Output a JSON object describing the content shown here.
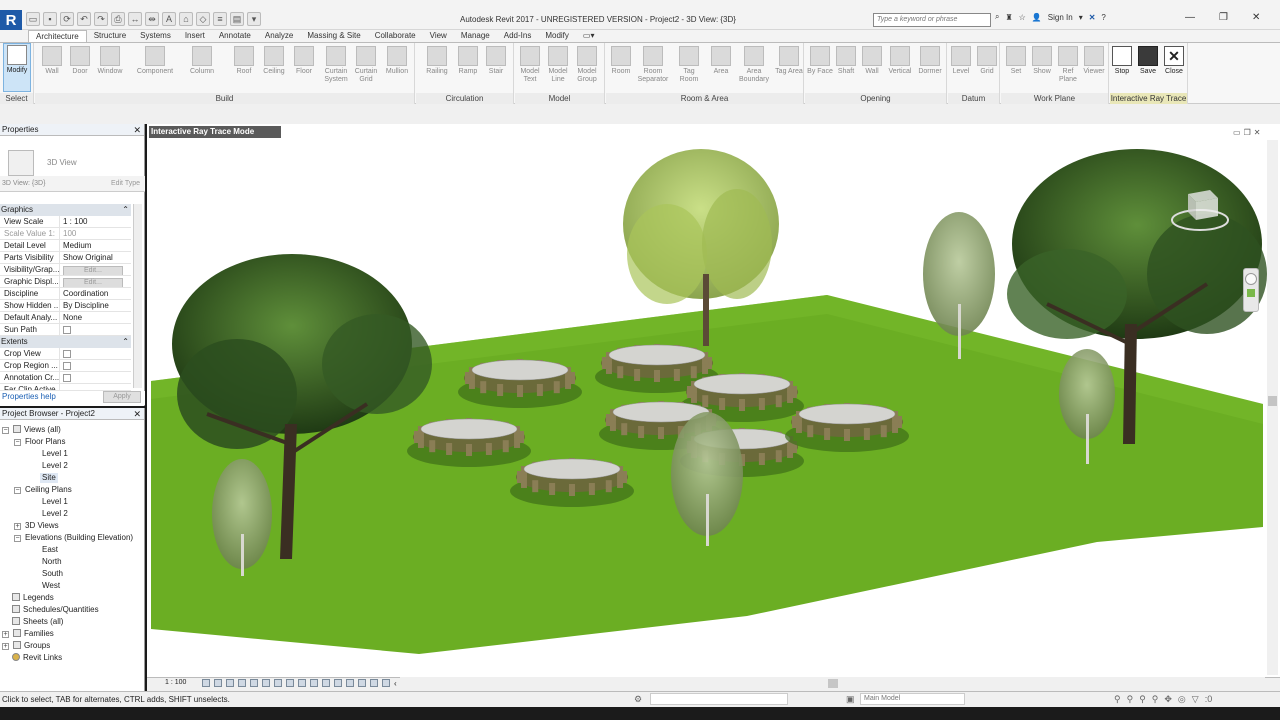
{
  "app": {
    "logo_letter": "R",
    "window_title": "Autodesk Revit 2017 -   UNREGISTERED VERSION -     Project2 - 3D View: {3D}",
    "search_placeholder": "Type a keyword or phrase",
    "sign_in": "Sign In"
  },
  "tabs": [
    "Architecture",
    "Structure",
    "Systems",
    "Insert",
    "Annotate",
    "Analyze",
    "Massing & Site",
    "Collaborate",
    "View",
    "Manage",
    "Add-Ins",
    "Modify"
  ],
  "active_tab": "Architecture",
  "ribbon": {
    "select": {
      "button": "Modify",
      "label": "Select"
    },
    "build": {
      "label": "Build",
      "buttons": [
        "Wall",
        "Door",
        "Window",
        "Component",
        "Column",
        "Roof",
        "Ceiling",
        "Floor",
        "Curtain System",
        "Curtain Grid",
        "Mullion"
      ]
    },
    "circulation": {
      "label": "Circulation",
      "buttons": [
        "Railing",
        "Ramp",
        "Stair"
      ]
    },
    "model": {
      "label": "Model",
      "buttons": [
        "Model Text",
        "Model Line",
        "Model Group"
      ]
    },
    "room_area": {
      "label": "Room & Area",
      "buttons": [
        "Room",
        "Room Separator",
        "Tag Room",
        "Area",
        "Area Boundary",
        "Tag Area"
      ]
    },
    "opening": {
      "label": "Opening",
      "buttons": [
        "By Face",
        "Shaft",
        "Wall",
        "Vertical",
        "Dormer"
      ]
    },
    "datum": {
      "label": "Datum",
      "buttons": [
        "Level",
        "Grid"
      ]
    },
    "work_plane": {
      "label": "Work Plane",
      "buttons": [
        "Set",
        "Show",
        "Ref Plane",
        "Viewer"
      ]
    },
    "interactive_ray_trace": {
      "label": "Interactive Ray Trace",
      "buttons": [
        "Stop",
        "Save",
        "Close"
      ]
    }
  },
  "properties": {
    "title": "Properties",
    "type_name": "3D View",
    "view_selector": "3D View: {3D}",
    "edit_type": "Edit Type",
    "groups": [
      {
        "name": "Graphics",
        "rows": [
          {
            "k": "View Scale",
            "v": "1 : 100"
          },
          {
            "k": "Scale Value    1:",
            "v": "100"
          },
          {
            "k": "Detail Level",
            "v": "Medium"
          },
          {
            "k": "Parts Visibility",
            "v": "Show Original"
          },
          {
            "k": "Visibility/Grap...",
            "v": "Edit..."
          },
          {
            "k": "Graphic Displ...",
            "v": "Edit..."
          },
          {
            "k": "Discipline",
            "v": "Coordination"
          },
          {
            "k": "Show Hidden ...",
            "v": "By Discipline"
          },
          {
            "k": "Default Analy...",
            "v": "None"
          },
          {
            "k": "Sun Path",
            "v": ""
          }
        ]
      },
      {
        "name": "Extents",
        "rows": [
          {
            "k": "Crop View",
            "v": ""
          },
          {
            "k": "Crop Region ...",
            "v": ""
          },
          {
            "k": "Annotation Cr...",
            "v": ""
          },
          {
            "k": "Far Clip Active",
            "v": ""
          }
        ]
      }
    ],
    "help_link": "Properties help",
    "apply": "Apply"
  },
  "project_browser": {
    "title": "Project Browser - Project2",
    "nodes": [
      "Views (all)",
      "Floor Plans",
      "Level 1",
      "Level 2",
      "Site",
      "Ceiling Plans",
      "Level 1",
      "Level 2",
      "3D Views",
      "Elevations (Building Elevation)",
      "East",
      "North",
      "South",
      "West",
      "Legends",
      "Schedules/Quantities",
      "Sheets (all)",
      "Families",
      "Groups",
      "Revit Links"
    ]
  },
  "view": {
    "mode_banner": "Interactive Ray Trace Mode",
    "scale": "1 : 100"
  },
  "status": {
    "message": "Click to select, TAB for alternates, CTRL adds, SHIFT unselects.",
    "model": "Main Model",
    "filter_count": ":0"
  }
}
